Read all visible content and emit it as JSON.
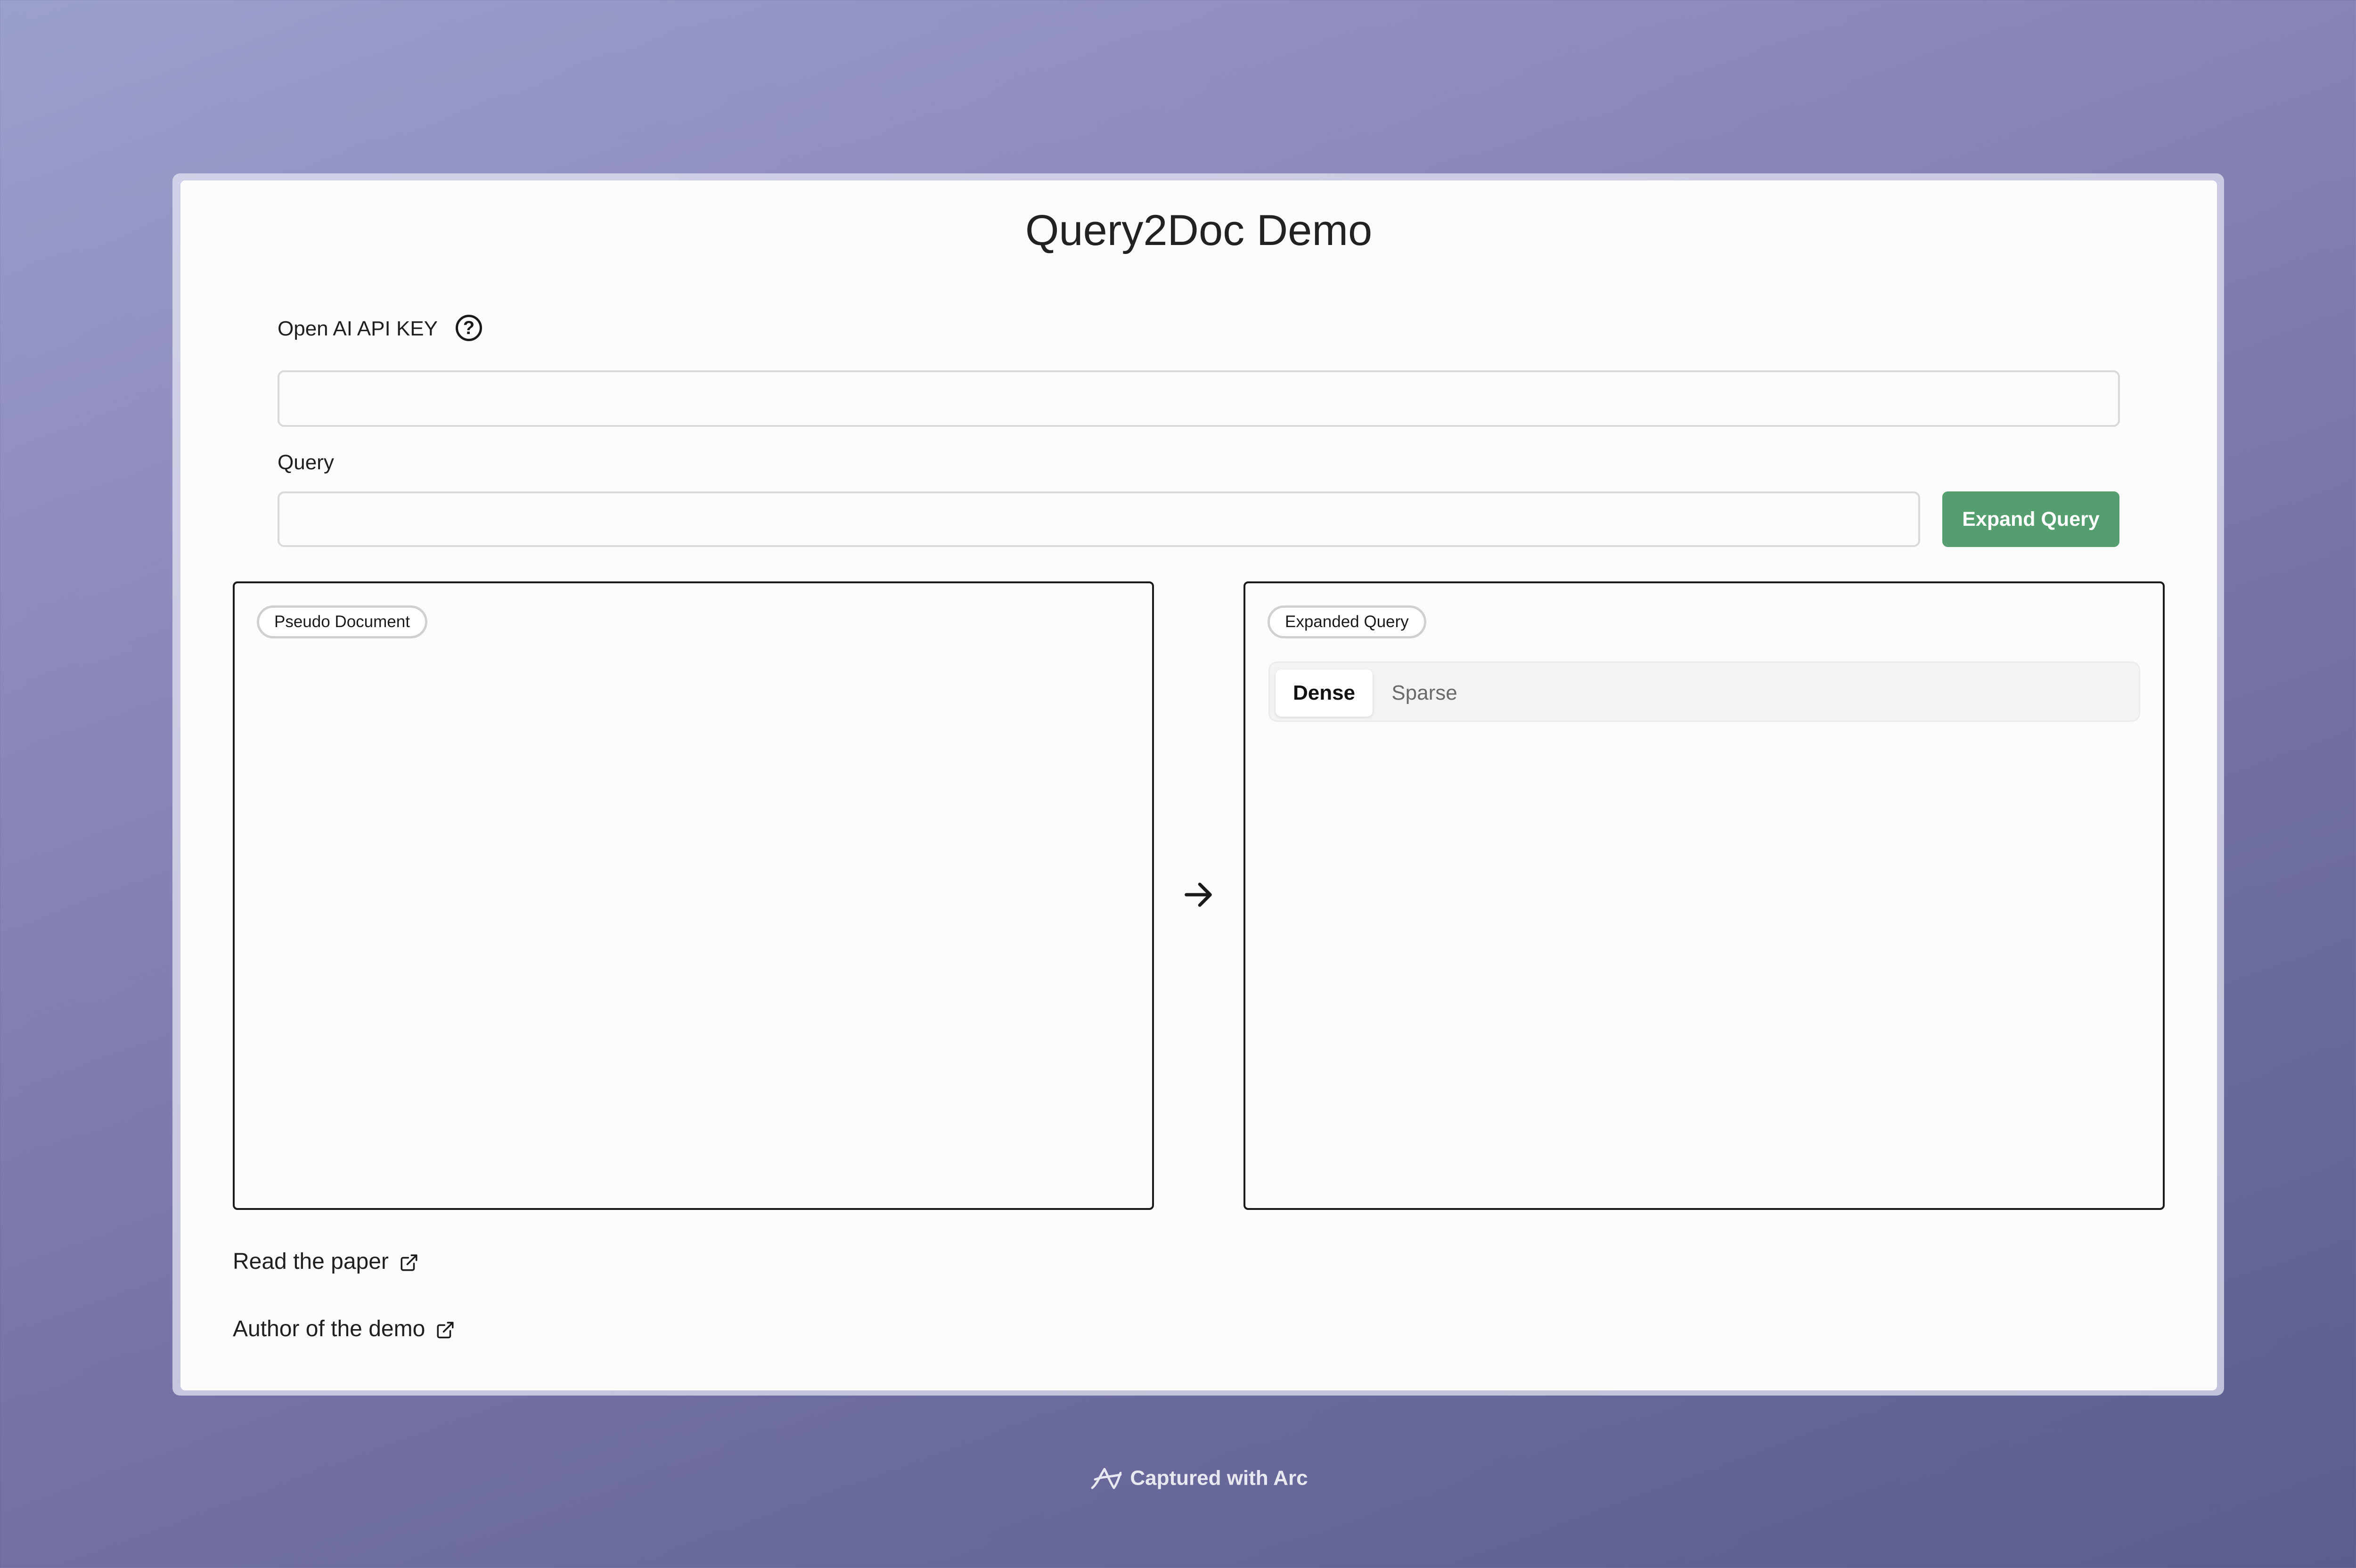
{
  "app": {
    "title": "Query2Doc Demo"
  },
  "api_key": {
    "label": "Open AI API KEY",
    "value": "",
    "placeholder": ""
  },
  "query": {
    "label": "Query",
    "value": "",
    "placeholder": ""
  },
  "expand_button": {
    "label": "Expand Query"
  },
  "pseudo_document": {
    "label": "Pseudo Document"
  },
  "expanded_query": {
    "label": "Expanded Query",
    "tabs": [
      {
        "label": "Dense",
        "active": true
      },
      {
        "label": "Sparse",
        "active": false
      }
    ]
  },
  "links": {
    "paper": "Read the paper",
    "author": "Author of the demo"
  },
  "footer": {
    "captured": "Captured with Arc"
  },
  "colors": {
    "accent": "#559e6f",
    "background_top": "#9aa0cc",
    "background_bottom": "#5a5d8d"
  },
  "icons": {
    "help": "question-circle-icon",
    "arrow": "arrow-right-icon",
    "external": "external-link-icon"
  }
}
